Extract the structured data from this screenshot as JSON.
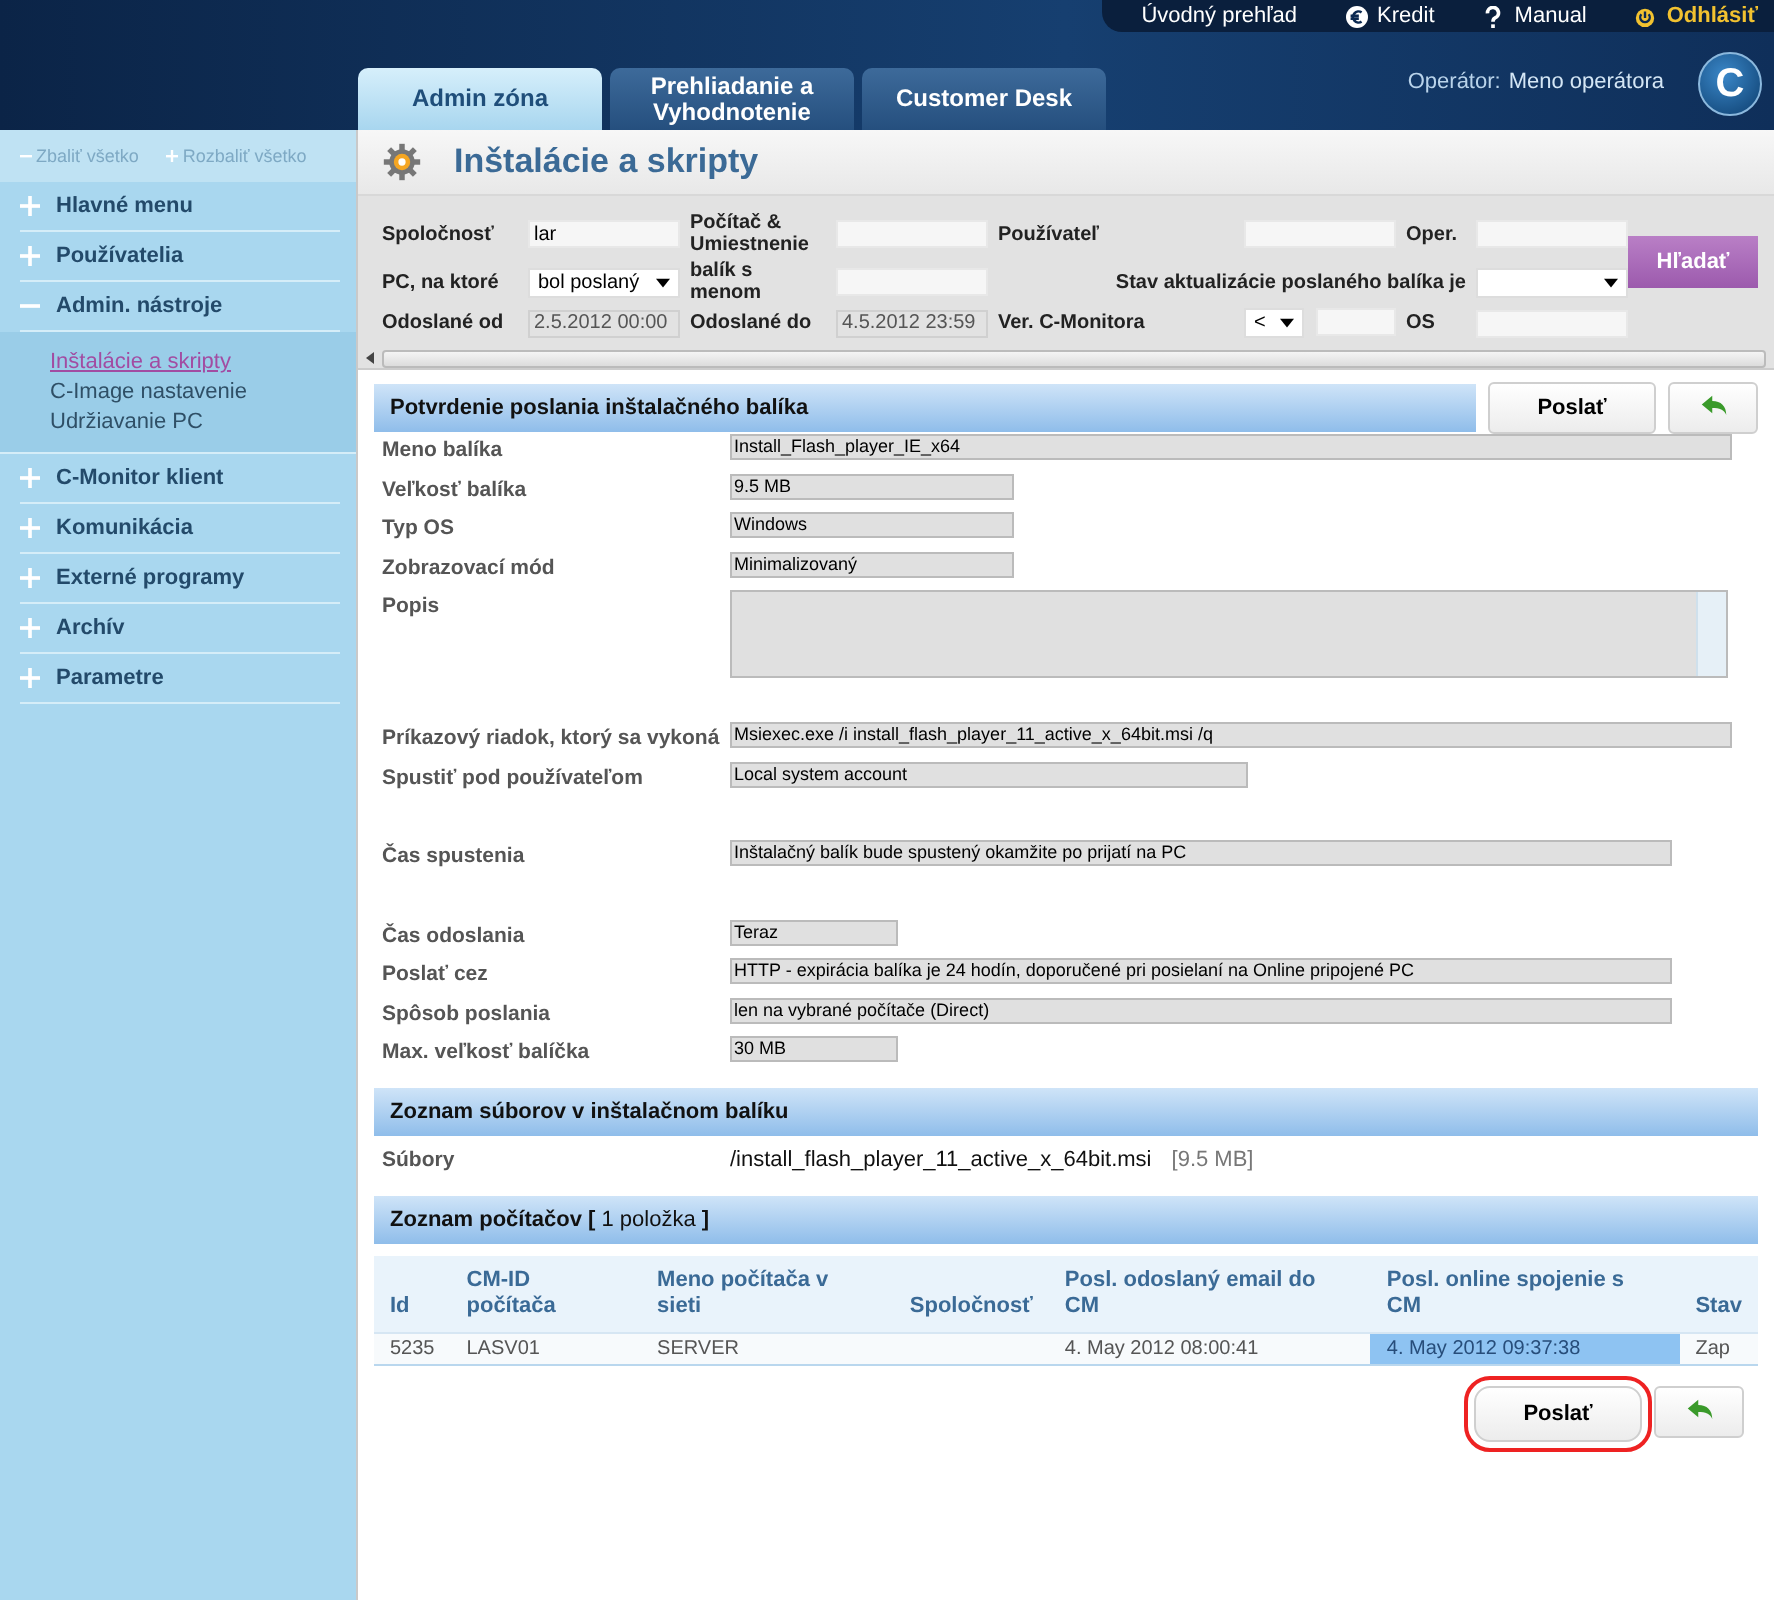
{
  "top_links": [
    {
      "kind": "home",
      "label": "Úvodný prehľad"
    },
    {
      "kind": "euro",
      "label": "Kredit"
    },
    {
      "kind": "help",
      "label": "Manual"
    },
    {
      "kind": "logout",
      "label": "Odhlásiť"
    }
  ],
  "tabs": [
    {
      "label": "Admin zóna",
      "selected": true
    },
    {
      "label": "Prehliadanie a Vyhodnotenie",
      "selected": false
    },
    {
      "label": "Customer Desk",
      "selected": false
    }
  ],
  "operator": {
    "label": "Operátor:",
    "name": "Meno operátora"
  },
  "logo": "C",
  "sidebar": {
    "collapse_all": "Zbaliť všetko",
    "expand_all": "Rozbaliť všetko",
    "items": [
      {
        "label": "Hlavné menu",
        "expanded": false
      },
      {
        "label": "Používatelia",
        "expanded": false
      },
      {
        "label": "Admin. nástroje",
        "expanded": true,
        "children": [
          {
            "label": "Inštalácie a skripty",
            "selected": true
          },
          {
            "label": "C-Image nastavenie",
            "selected": false
          },
          {
            "label": "Udržiavanie PC",
            "selected": false
          }
        ]
      },
      {
        "label": "C-Monitor klient",
        "expanded": false
      },
      {
        "label": "Komunikácia",
        "expanded": false
      },
      {
        "label": "Externé programy",
        "expanded": false
      },
      {
        "label": "Archív",
        "expanded": false
      },
      {
        "label": "Parametre",
        "expanded": false
      }
    ]
  },
  "page_title": "Inštalácie a skripty",
  "filters": {
    "rows": [
      [
        {
          "label": "Spoločnosť",
          "kind": "text",
          "value": "lar"
        },
        {
          "label": "Počítač & Umiestnenie",
          "kind": "text"
        },
        {
          "label": "Používateľ",
          "kind": "text"
        },
        {
          "label": "Oper.",
          "kind": "text"
        }
      ],
      [
        {
          "label": "PC, na ktoré",
          "kind": "select",
          "value": "bol poslaný"
        },
        {
          "label": "balík s menom",
          "kind": "text"
        },
        {
          "label": "Stav aktualizácie poslaného balíka je",
          "kind": "select"
        }
      ],
      [
        {
          "label": "Odoslané od",
          "kind": "readonly",
          "value": "2.5.2012 00:00"
        },
        {
          "label": "Odoslané do",
          "kind": "readonly",
          "value": "4.5.2012 23:59"
        },
        {
          "label": "Ver. C-Monitora",
          "kind": "select_text",
          "value": "<"
        },
        {
          "label": "OS",
          "kind": "text"
        }
      ]
    ],
    "search_button": "Hľadať"
  },
  "confirm_section": {
    "title": "Potvrdenie poslania inštalačného balíka",
    "send_button": "Poslať"
  },
  "details": [
    {
      "label": "Meno balíka",
      "value": "Install_Flash_player_IE_x64",
      "kind": "field"
    },
    {
      "label": "Veľkosť balíka",
      "value": "9.5 MB",
      "kind": "field"
    },
    {
      "label": "Typ OS",
      "value": "Windows",
      "kind": "field"
    },
    {
      "label": "Zobrazovací mód",
      "value": "Minimalizovaný",
      "kind": "field"
    },
    {
      "label": "Popis",
      "kind": "textarea"
    },
    {
      "label": "Príkazový riadok, ktorý sa vykoná",
      "value": "Msiexec.exe /i install_flash_player_11_active_x_64bit.msi /q",
      "kind": "field"
    },
    {
      "label": "Spustiť pod používateľom",
      "value": "Local system account",
      "kind": "field"
    },
    {
      "label": "Čas spustenia",
      "value": "Inštalačný balík bude spustený okamžite po prijatí na PC",
      "kind": "field"
    },
    {
      "label": "Čas odoslania",
      "value": "Teraz",
      "kind": "field"
    },
    {
      "label": "Poslať cez",
      "value": "HTTP   -   expirácia balíka je 24 hodín, doporučené pri posielaní na Online pripojené PC",
      "kind": "field"
    },
    {
      "label": "Spôsob poslania",
      "value": "len na vybrané počítače (Direct)",
      "kind": "field"
    },
    {
      "label": "Max. veľkosť balíčka",
      "value": "30 MB",
      "kind": "field"
    }
  ],
  "files_section": {
    "title": "Zoznam súborov v inštalačnom balíku",
    "label": "Súbory",
    "file": "/install_flash_player_11_active_x_64bit.msi",
    "size": "[9.5 MB]"
  },
  "computers_section": {
    "title": "**Zoznam počítačov [** 1 položka **]**",
    "columns": [
      "Id",
      "CM-ID počítača",
      "Meno počítača v sieti",
      "Spoločnosť",
      "Posl. odoslaný email do CM",
      "Posl. online spojenie s CM",
      "Stav"
    ],
    "rows": [
      {
        "cells": [
          {
            "text": "5235",
            "highlighted": false
          },
          {
            "text": "LASV01",
            "highlighted": false
          },
          {
            "text": "SERVER",
            "highlighted": false
          },
          {
            "highlighted": false
          },
          {
            "text": "4. May 2012 08:00:41",
            "highlighted": false
          },
          {
            "text": "4. May 2012 09:37:38",
            "highlighted": true
          },
          {
            "text": "Zap",
            "highlighted": false
          }
        ]
      }
    ],
    "send_button": {
      "label": "Poslať",
      "highlighted": true
    }
  }
}
